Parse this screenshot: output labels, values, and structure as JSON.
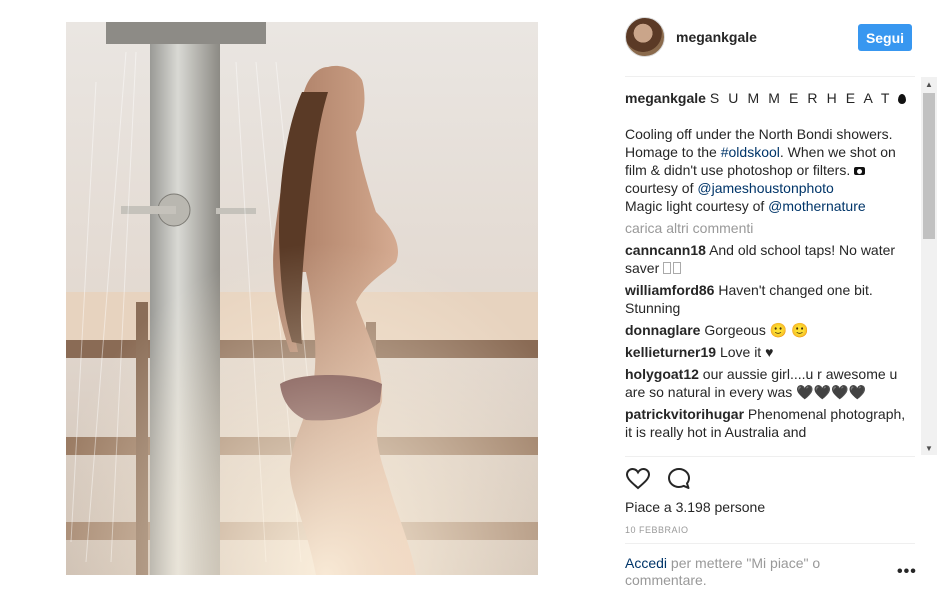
{
  "post": {
    "username": "megankgale",
    "follow_label": "Segui",
    "caption_title": "S U M M E R H E A T",
    "caption_icon": "water-drop-icon",
    "caption_line1": "Cooling off under the North Bondi showers. Homage to the ",
    "hashtag": "#oldskool",
    "caption_line2": ". When we shot on film & didn't use photoshop or filters. ",
    "camera_icon": "camera-icon",
    "caption_line3": " courtesy of ",
    "mention1": "@jameshoustonphoto",
    "caption_line4": "Magic light courtesy of ",
    "mention2": "@mothernature",
    "load_more": "carica altri commenti",
    "likes": "Piace a 3.198 persone",
    "date": "10 FEBBRAIO",
    "login_link": "Accedi",
    "login_text": " per mettere \"Mi piace\" o commentare.",
    "more_label": "•••"
  },
  "comments": [
    {
      "user": "canncann18",
      "text": "And old school taps! No water saver"
    },
    {
      "user": "williamford86",
      "text": "Haven't changed one bit. Stunning"
    },
    {
      "user": "donnaglare",
      "text": "Gorgeous 🙂 🙂"
    },
    {
      "user": "kellieturner19",
      "text": "Love it ♥"
    },
    {
      "user": "holygoat12",
      "text": "our aussie girl....u r awesome u are so natural in every was 🖤🖤🖤🖤"
    },
    {
      "user": "patrickvitorihugar",
      "text": "Phenomenal photograph, it is really hot in Australia and"
    }
  ],
  "scrollbar": {
    "up": "▲",
    "down": "▼"
  }
}
